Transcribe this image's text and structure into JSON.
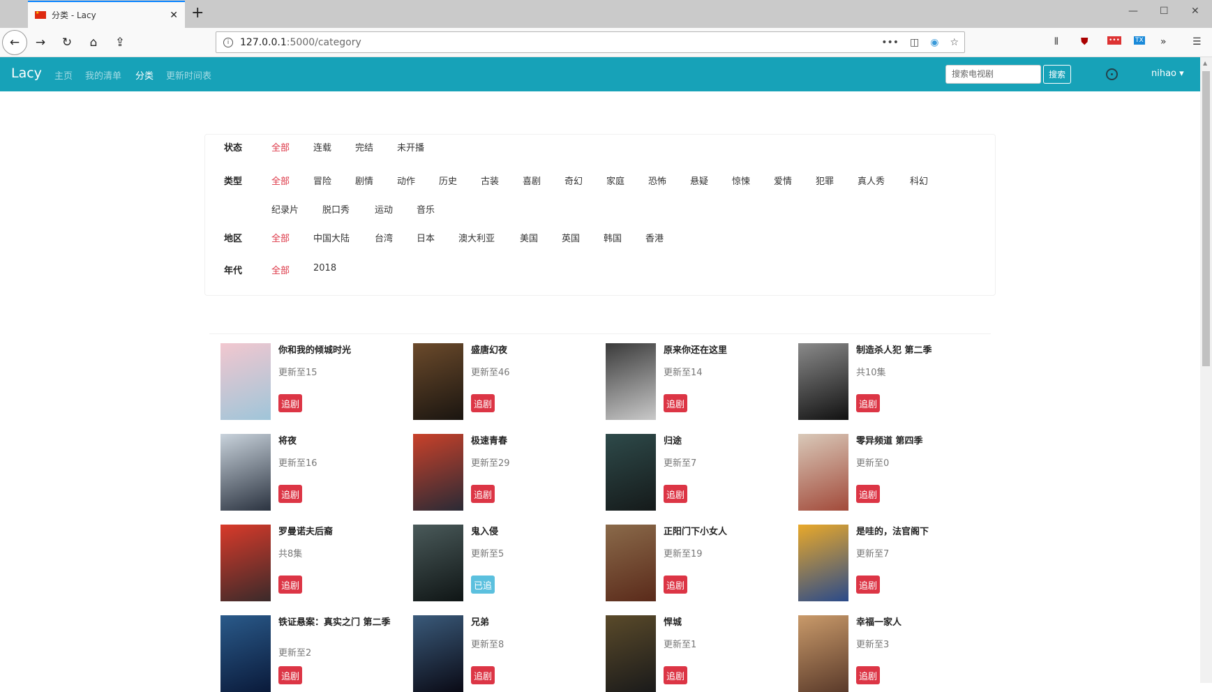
{
  "browser": {
    "tab_title": "分类 - Lacy",
    "url_host": "127.0.0.1",
    "url_rest": ":5000/category"
  },
  "app": {
    "brand": "Lacy",
    "nav": [
      "主页",
      "我的清单",
      "分类",
      "更新时间表"
    ],
    "active_nav": 2,
    "search_placeholder": "搜索电视剧",
    "search_button": "搜索",
    "user": "nihao ▾"
  },
  "filters": {
    "status": {
      "label": "状态",
      "options": [
        "全部",
        "连载",
        "完结",
        "未开播"
      ]
    },
    "genre": {
      "label": "类型",
      "options": [
        "全部",
        "冒险",
        "剧情",
        "动作",
        "历史",
        "古装",
        "喜剧",
        "奇幻",
        "家庭",
        "恐怖",
        "悬疑",
        "惊悚",
        "爱情",
        "犯罪",
        "真人秀",
        "科幻",
        "纪录片",
        "脱口秀",
        "运动",
        "音乐"
      ]
    },
    "region": {
      "label": "地区",
      "options": [
        "全部",
        "中国大陆",
        "台湾",
        "日本",
        "澳大利亚",
        "美国",
        "英国",
        "韩国",
        "香港"
      ]
    },
    "year": {
      "label": "年代",
      "options": [
        "全部",
        "2018"
      ]
    }
  },
  "shows": [
    {
      "title": "你和我的倾城时光",
      "status": "更新至15",
      "button": "追剧",
      "following": false,
      "colors": [
        "#f2c7cf",
        "#9fc5d9"
      ]
    },
    {
      "title": "盛唐幻夜",
      "status": "更新至46",
      "button": "追剧",
      "following": false,
      "colors": [
        "#6b4a2b",
        "#1a1510"
      ]
    },
    {
      "title": "原来你还在这里",
      "status": "更新至14",
      "button": "追剧",
      "following": false,
      "colors": [
        "#3a3a3a",
        "#c9c9c9"
      ]
    },
    {
      "title": "制造杀人犯 第二季",
      "status": "共10集",
      "button": "追剧",
      "following": false,
      "colors": [
        "#8a8a8a",
        "#111111"
      ]
    },
    {
      "title": "将夜",
      "status": "更新至16",
      "button": "追剧",
      "following": false,
      "colors": [
        "#c9d3dc",
        "#2b3340"
      ]
    },
    {
      "title": "极速青春",
      "status": "更新至29",
      "button": "追剧",
      "following": false,
      "colors": [
        "#c9412a",
        "#2a2a35"
      ]
    },
    {
      "title": "归途",
      "status": "更新至7",
      "button": "追剧",
      "following": false,
      "colors": [
        "#2e4a4a",
        "#151a1a"
      ]
    },
    {
      "title": "零异频道 第四季",
      "status": "更新至0",
      "button": "追剧",
      "following": false,
      "colors": [
        "#d9c9b9",
        "#a24a3a"
      ]
    },
    {
      "title": "罗曼诺夫后裔",
      "status": "共8集",
      "button": "追剧",
      "following": false,
      "colors": [
        "#d93a2a",
        "#3a2a2a"
      ]
    },
    {
      "title": "鬼入侵",
      "status": "更新至5",
      "button": "已追",
      "following": true,
      "colors": [
        "#4a5a5a",
        "#0f1515"
      ]
    },
    {
      "title": "正阳门下小女人",
      "status": "更新至19",
      "button": "追剧",
      "following": false,
      "colors": [
        "#8a6a4a",
        "#5a2a1a"
      ]
    },
    {
      "title": "是哇的，法官阁下",
      "status": "更新至7",
      "button": "追剧",
      "following": false,
      "colors": [
        "#e9a92a",
        "#2a4a8a"
      ]
    },
    {
      "title": "铁证悬案：真实之门 第二季",
      "status": "更新至2",
      "button": "追剧",
      "following": false,
      "colors": [
        "#2a5a8a",
        "#0a1a3a"
      ]
    },
    {
      "title": "兄弟",
      "status": "更新至8",
      "button": "追剧",
      "following": false,
      "colors": [
        "#3a5a7a",
        "#0a0a15"
      ]
    },
    {
      "title": "悍城",
      "status": "更新至1",
      "button": "追剧",
      "following": false,
      "colors": [
        "#5a4a2a",
        "#1a1a1a"
      ]
    },
    {
      "title": "幸福一家人",
      "status": "更新至3",
      "button": "追剧",
      "following": false,
      "colors": [
        "#c99a6a",
        "#5a3a2a"
      ]
    }
  ]
}
